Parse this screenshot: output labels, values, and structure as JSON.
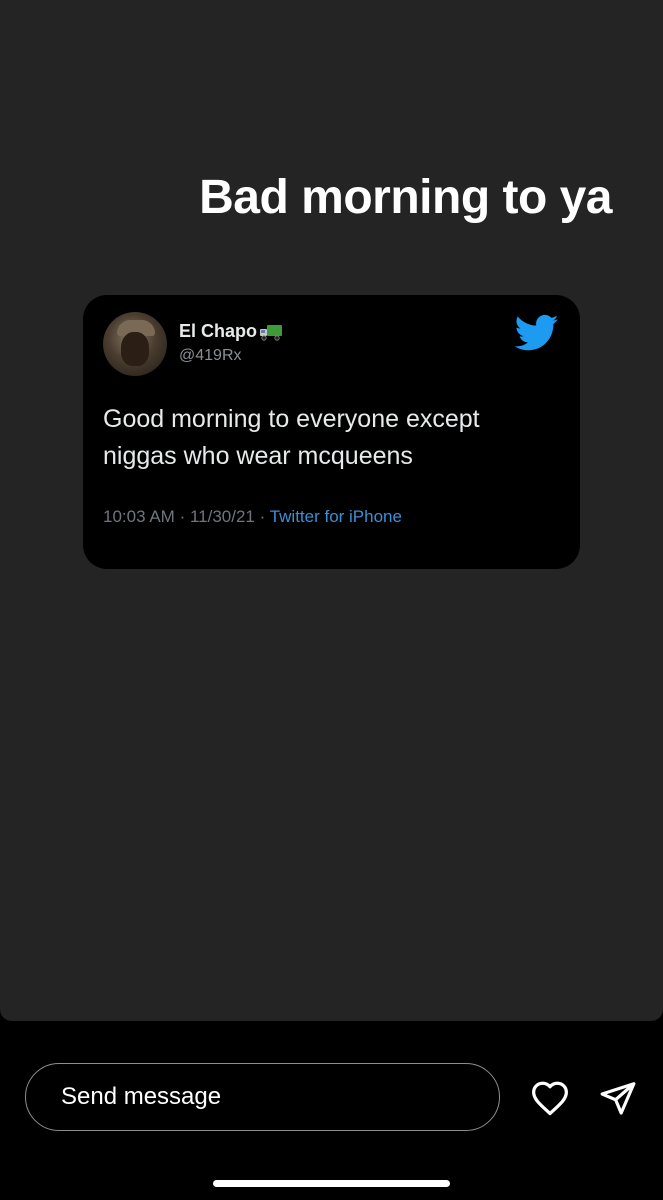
{
  "story": {
    "caption": "Bad morning to ya"
  },
  "tweet": {
    "display_name": "El Chapo",
    "name_emoji_icon": "truck-icon",
    "handle": "@419Rx",
    "text_line1": "Good morning to everyone except",
    "text_line2": "niggas who wear mcqueens",
    "time": "10:03 AM",
    "date": "11/30/21",
    "source": "Twitter for iPhone",
    "brand_icon": "twitter-bird-icon",
    "colors": {
      "twitter_blue": "#1d9bf0",
      "source_link": "#3b8fd6",
      "card_bg": "#000000"
    }
  },
  "reply_bar": {
    "placeholder": "Send message",
    "like_icon": "heart-icon",
    "share_icon": "send-icon"
  },
  "colors": {
    "story_bg": "#242424",
    "app_bg": "#000000"
  }
}
